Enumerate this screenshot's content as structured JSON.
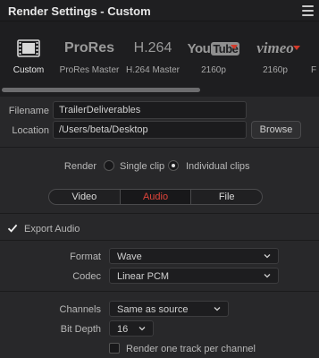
{
  "window": {
    "title": "Render Settings - Custom"
  },
  "presets": [
    {
      "label": "Custom",
      "logo": "film-icon",
      "active": true
    },
    {
      "label": "ProRes Master",
      "logo_text": "ProRes"
    },
    {
      "label": "H.264 Master",
      "logo_text": "H.264"
    },
    {
      "label": "2160p",
      "logo_text": "YouTube",
      "logo_you": "You",
      "logo_tube": "Tube"
    },
    {
      "label": "2160p",
      "logo_text": "vimeo"
    },
    {
      "label": "F",
      "logo_text": ""
    }
  ],
  "file": {
    "filename_label": "Filename",
    "filename_value": "TrailerDeliverables",
    "location_label": "Location",
    "location_value": "/Users/beta/Desktop",
    "browse_label": "Browse"
  },
  "render": {
    "label": "Render",
    "single_clip": "Single clip",
    "individual_clips": "Individual clips",
    "selected": "individual_clips"
  },
  "tabs": [
    {
      "label": "Video",
      "active": false
    },
    {
      "label": "Audio",
      "active": true
    },
    {
      "label": "File",
      "active": false
    }
  ],
  "audio": {
    "export_label": "Export Audio",
    "export_checked": true,
    "format_label": "Format",
    "format_value": "Wave",
    "codec_label": "Codec",
    "codec_value": "Linear PCM",
    "channels_label": "Channels",
    "channels_value": "Same as source",
    "bitdepth_label": "Bit Depth",
    "bitdepth_value": "16",
    "per_channel_label": "Render one track per channel",
    "per_channel_checked": false
  },
  "colors": {
    "accent_red": "#e0443a",
    "panel_bg": "#28282a",
    "field_bg": "#1b1b1d"
  }
}
